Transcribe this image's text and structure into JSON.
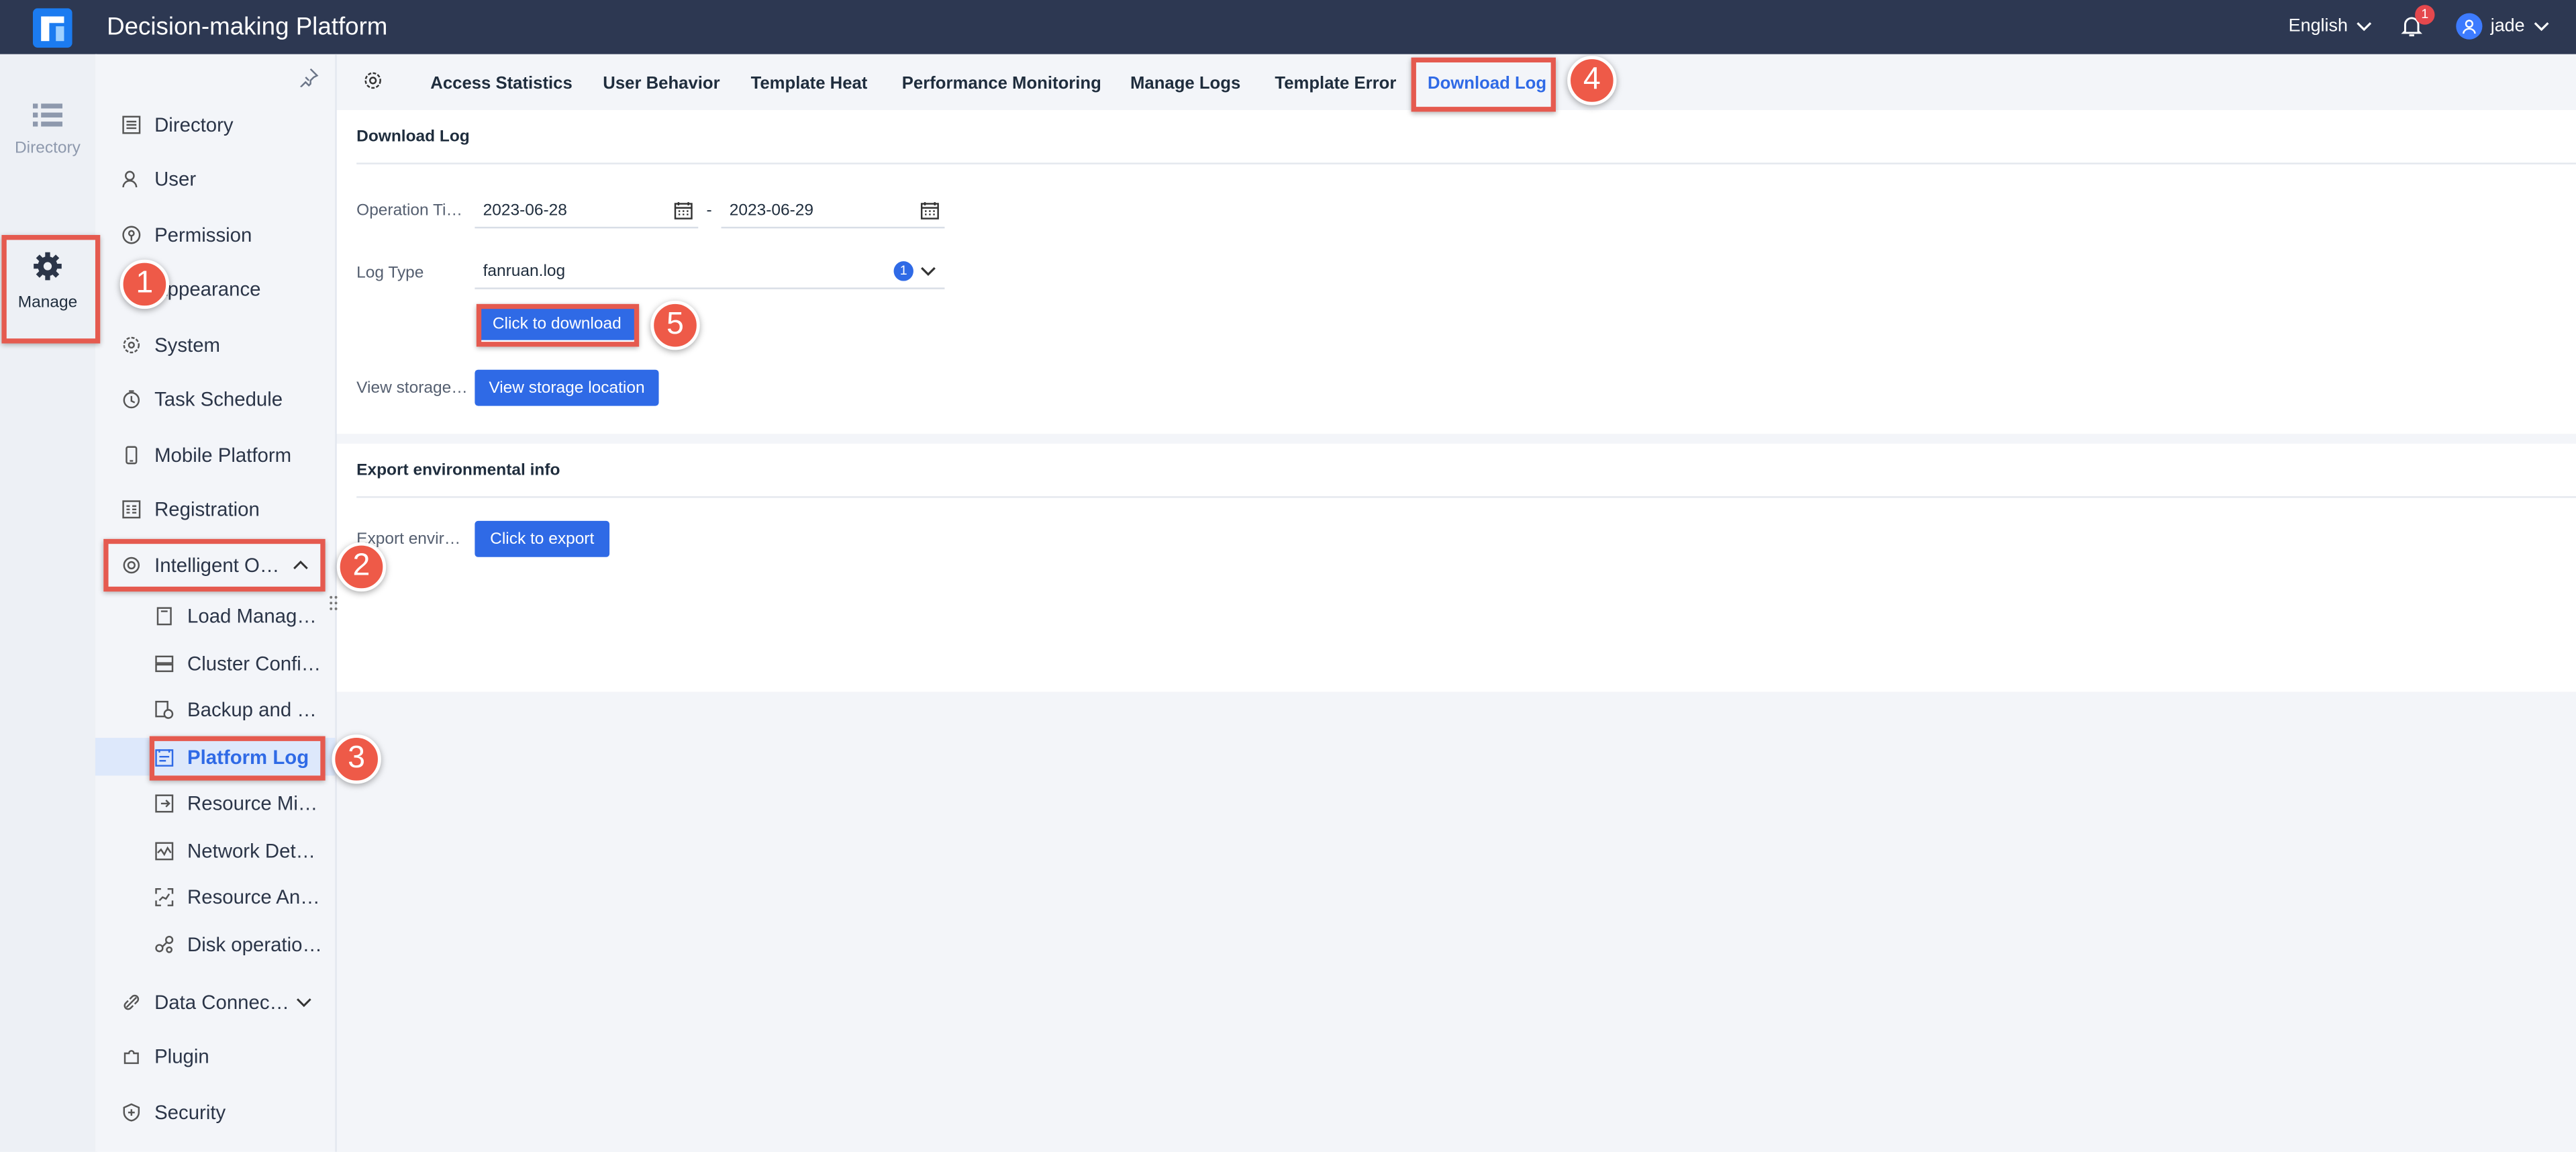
{
  "app": {
    "title": "Decision-making Platform"
  },
  "topbar": {
    "language": "English",
    "notifications_count": "1",
    "username": "jade"
  },
  "rail": [
    {
      "label": "Directory",
      "icon": "list-icon"
    },
    {
      "label": "Manage",
      "icon": "gear-icon"
    }
  ],
  "sidebar": {
    "items": [
      {
        "label": "Directory",
        "icon": "directory-icon"
      },
      {
        "label": "User",
        "icon": "user-icon"
      },
      {
        "label": "Permission",
        "icon": "permission-icon"
      },
      {
        "label": "Appearance",
        "icon": "appearance-icon"
      },
      {
        "label": "System",
        "icon": "system-gear-icon"
      },
      {
        "label": "Task Schedule",
        "icon": "clock-icon"
      },
      {
        "label": "Mobile Platform",
        "icon": "mobile-icon"
      },
      {
        "label": "Registration",
        "icon": "registration-icon"
      },
      {
        "label": "Intelligent O…",
        "icon": "operations-icon"
      },
      {
        "label": "Data Connec…",
        "icon": "link-icon"
      },
      {
        "label": "Plugin",
        "icon": "plugin-icon"
      },
      {
        "label": "Security",
        "icon": "shield-icon"
      }
    ],
    "subitems": [
      {
        "label": "Load Manag…"
      },
      {
        "label": "Cluster Confi…"
      },
      {
        "label": "Backup and …"
      },
      {
        "label": "Platform Log"
      },
      {
        "label": "Resource Mi…"
      },
      {
        "label": "Network Det…"
      },
      {
        "label": "Resource An…"
      },
      {
        "label": "Disk operatio…"
      }
    ]
  },
  "tabs": [
    "Access Statistics",
    "User Behavior",
    "Template Heat",
    "Performance Monitoring",
    "Manage Logs",
    "Template Error",
    "Download Log"
  ],
  "download": {
    "section_title": "Download Log",
    "op_time_label": "Operation Ti…",
    "date_from": "2023-06-28",
    "date_sep": "-",
    "date_to": "2023-06-29",
    "log_type_label": "Log Type",
    "log_type_value": "fanruan.log",
    "log_type_count": "1",
    "download_button": "Click to download",
    "storage_label": "View storage…",
    "storage_button": "View storage location"
  },
  "export": {
    "section_title": "Export environmental info",
    "label": "Export envir…",
    "button": "Click to export"
  },
  "steps": [
    "1",
    "2",
    "3",
    "4",
    "5"
  ],
  "colors": {
    "accent": "#2f6ae6",
    "topbar": "#2d3852",
    "highlight": "#e55a4f"
  }
}
